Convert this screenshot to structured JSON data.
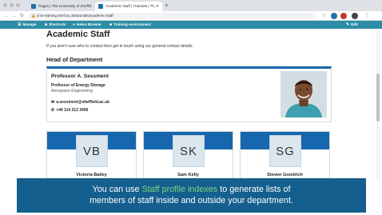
{
  "browser": {
    "tabs": [
      {
        "title": "Pages | The University of Sheff...",
        "active": false
      },
      {
        "title": "Academic Staff | Tutorials | Th...",
        "active": true
      }
    ],
    "url": "cms-training.shef.ac.uk/tutorials/academic-staff"
  },
  "adminbar": {
    "manage": "Manage",
    "shortcuts": "Shortcuts",
    "user": "Helen Browne",
    "environment": "Training environment",
    "edit": "Edit"
  },
  "page": {
    "title": "Academic Staff",
    "intro": "If you aren't sure who to contact then get in touch using our general contact details.",
    "section_heading": "Head of Department"
  },
  "head_of_department": {
    "name": "Professor A. Sessment",
    "role": "Professor of Energy Storage",
    "department": "Aerospace Engineering",
    "email": "a.sessment@sheffield.ac.uk",
    "phone": "+44 114 212 3456"
  },
  "staff": [
    {
      "initials": "VB",
      "name": "Victoria Bailey"
    },
    {
      "initials": "SK",
      "name": "Sam Kelly"
    },
    {
      "initials": "SG",
      "name": "Steven Goodrich"
    }
  ],
  "caption": {
    "before": "You can use ",
    "highlight": "Staff profile indexes",
    "after": " to generate lists of",
    "line2": "members of staff inside and outside your department."
  },
  "colors": {
    "admin_bar": "#2d8ca6",
    "accent_blue": "#1667ae",
    "caption_bg": "#145f8e",
    "caption_highlight": "#7dd47d"
  }
}
